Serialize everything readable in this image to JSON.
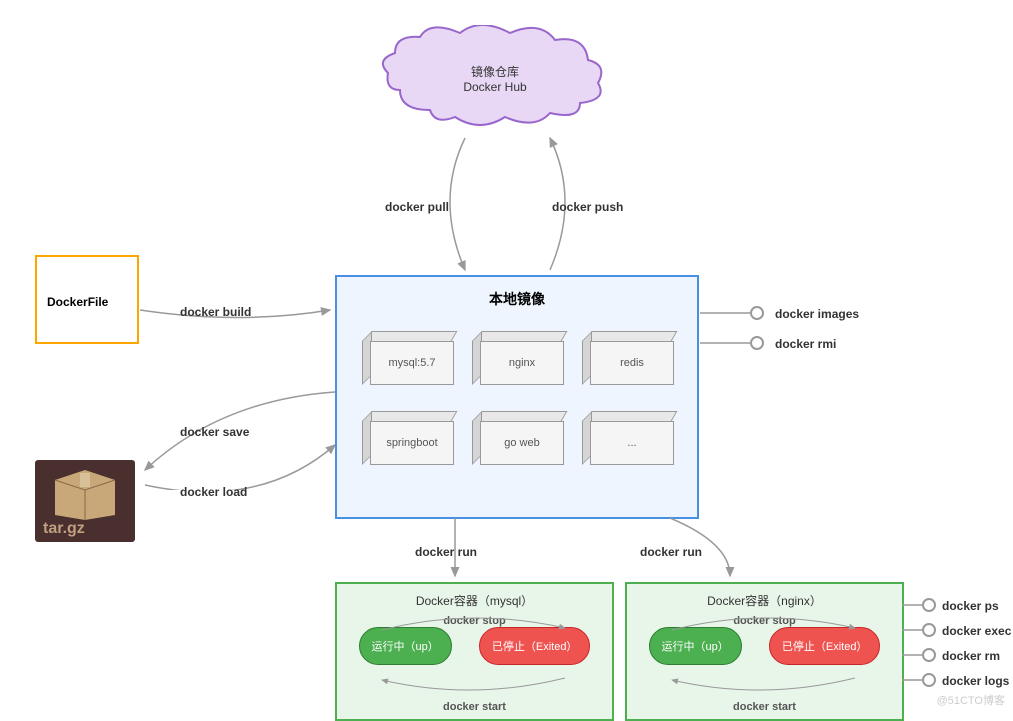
{
  "cloud": {
    "line1": "镜像仓库",
    "line2": "Docker Hub"
  },
  "dockerfile": {
    "label": "DockerFile"
  },
  "targz": {
    "label": "tar.gz"
  },
  "localImages": {
    "title": "本地镜像",
    "items": [
      "mysql:5.7",
      "nginx",
      "redis",
      "springboot",
      "go web",
      "..."
    ]
  },
  "containers": [
    {
      "title": "Docker容器（mysql）",
      "running": "运行中（up）",
      "stopped": "已停止（Exited）",
      "stop": "docker stop",
      "start": "docker start"
    },
    {
      "title": "Docker容器（nginx）",
      "running": "运行中（up）",
      "stopped": "已停止（Exited）",
      "stop": "docker stop",
      "start": "docker start"
    }
  ],
  "cmds": {
    "pull": "docker pull",
    "push": "docker push",
    "build": "docker  build",
    "save": "docker save",
    "load": "docker load",
    "run": "docker  run",
    "images": "docker images",
    "rmi": "docker rmi",
    "ps": "docker ps",
    "exec": "docker exec",
    "rm": "docker rm",
    "logs": "docker logs"
  },
  "watermark": "@51CTO博客"
}
